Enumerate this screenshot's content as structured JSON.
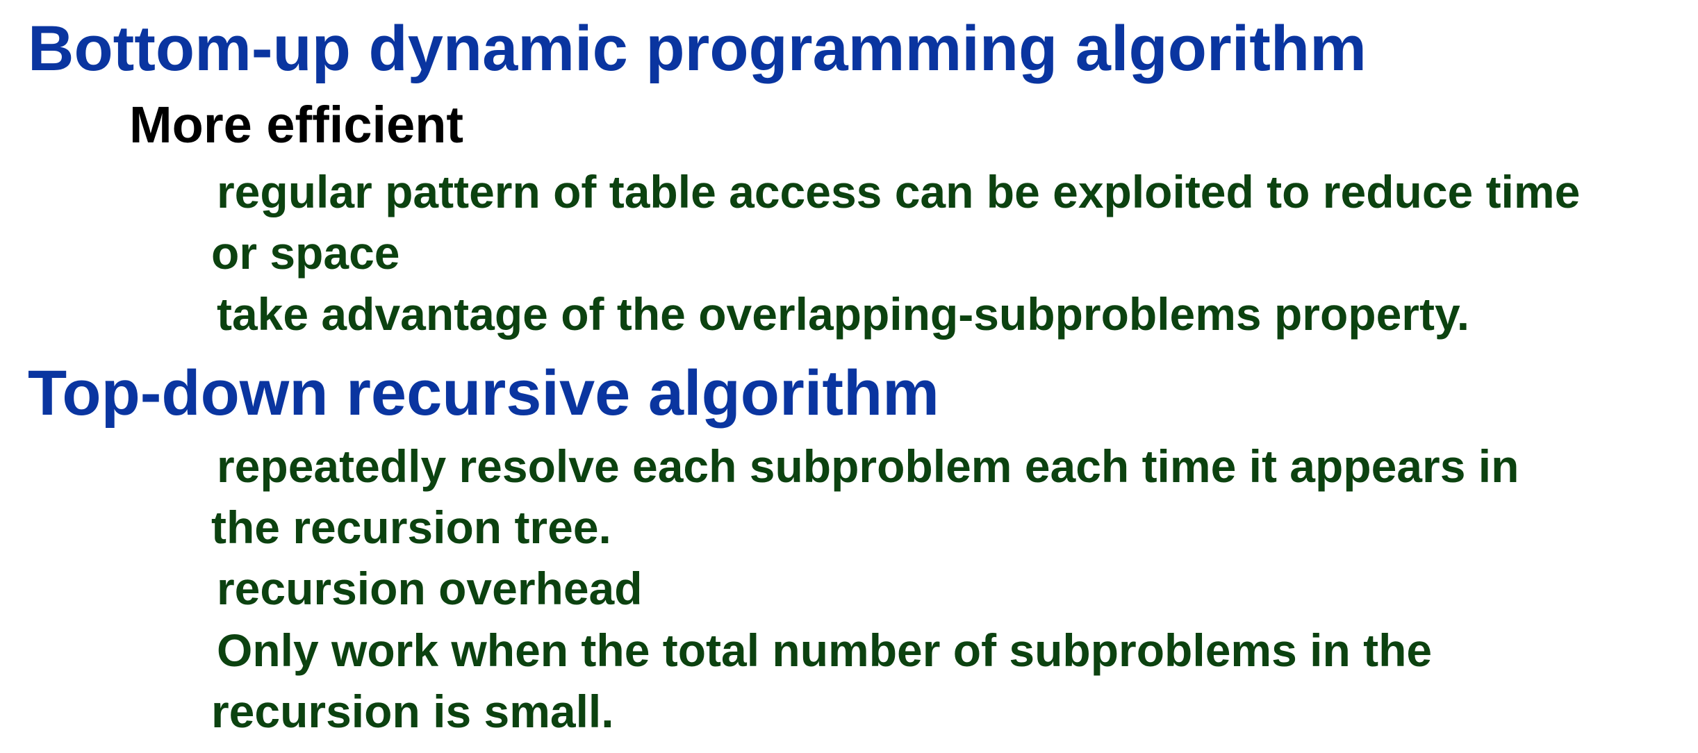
{
  "slide": {
    "sections": [
      {
        "heading": "Bottom-up dynamic programming algorithm",
        "subheading": "More efficient",
        "lines": [
          "regular pattern of table access can be exploited to reduce time",
          "or space",
          "take advantage of the overlapping-subproblems property."
        ]
      },
      {
        "heading": "Top-down recursive algorithm",
        "lines": [
          "repeatedly resolve each subproblem each time it appears in",
          "the recursion tree.",
          "recursion overhead",
          "Only work when the total number of subproblems in the",
          "recursion is small."
        ]
      }
    ],
    "colors": {
      "heading": "#0a35a0",
      "subheading": "#000000",
      "body": "#0c4210"
    }
  }
}
